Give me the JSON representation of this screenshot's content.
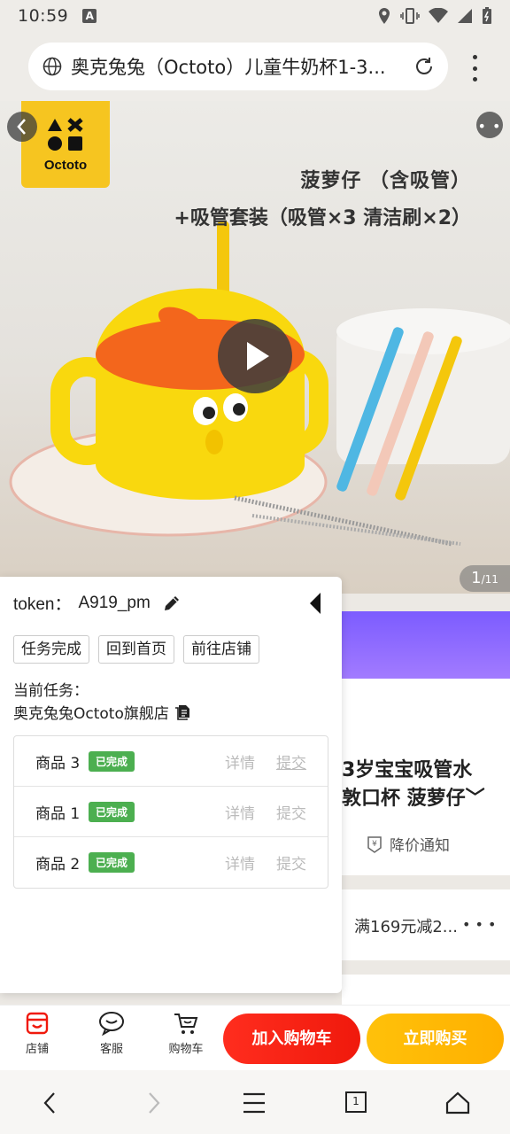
{
  "status_bar": {
    "time": "10:59",
    "notif_letter": "A"
  },
  "address_bar": {
    "url_text": "奥克兔兔（Octoto）儿童牛奶杯1-3..."
  },
  "hero": {
    "brand_logo_text": "Octoto",
    "headline_1": "菠萝仔 （含吸管）",
    "headline_2": "+吸管套装（吸管×3 清洁刷×2）",
    "image_index": "1",
    "image_total": "/11"
  },
  "product": {
    "title_line1": "3岁宝宝吸管水",
    "title_line2": "敦口杯 菠萝仔﹀",
    "price_notify": "降价通知",
    "coupon": "满169元减2...",
    "coupon_more": "• • •"
  },
  "task_panel": {
    "token_label": "token：",
    "token_value": "A919_pm",
    "buttons": [
      "任务完成",
      "回到首页",
      "前往店铺"
    ],
    "current_task_label": "当前任务：",
    "current_task_name": "奥克兔兔Octoto旗舰店",
    "tasks": [
      {
        "name": "商品 3",
        "status": "已完成",
        "detail": "详情",
        "submit": "提交"
      },
      {
        "name": "商品 1",
        "status": "已完成",
        "detail": "详情",
        "submit": "提交"
      },
      {
        "name": "商品 2",
        "status": "已完成",
        "detail": "详情",
        "submit": "提交"
      }
    ]
  },
  "action_bar": {
    "shop_label": "店铺",
    "service_label": "客服",
    "cart_label": "购物车",
    "add_to_cart": "加入购物车",
    "buy_now": "立即购买"
  },
  "nav_bar": {
    "tab_count": "1"
  },
  "colors": {
    "accent_red": "#f0190c",
    "accent_yellow": "#ffb000",
    "done_green": "#4caf50"
  }
}
